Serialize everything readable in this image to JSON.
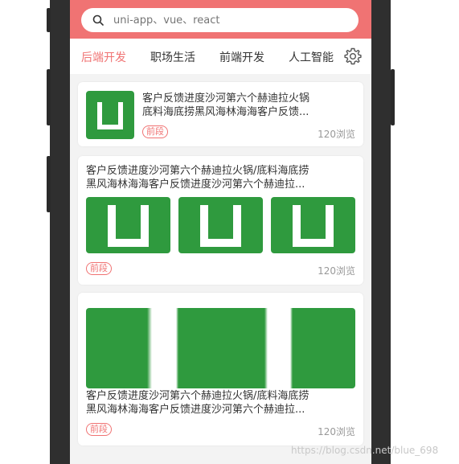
{
  "search": {
    "placeholder": "uni-app、vue、react"
  },
  "tabs": [
    {
      "label": "后端开发",
      "active": true
    },
    {
      "label": "职场生活",
      "active": false
    },
    {
      "label": "前端开发",
      "active": false
    },
    {
      "label": "人工智能",
      "active": false
    }
  ],
  "cards": [
    {
      "layout": "thumb-left",
      "title_line1": "客户反馈进度沙河第六个赫迪拉火锅",
      "title_line2": "底料海底捞黑风海林海海客户反馈...",
      "badge": "前段",
      "views": "120浏览"
    },
    {
      "layout": "three-images",
      "title_line1": "客户反馈进度沙河第六个赫迪拉火锅/底料海底捞",
      "title_line2": "黑风海林海海客户反馈进度沙河第六个赫迪拉...",
      "badge": "前段",
      "views": "120浏览"
    },
    {
      "layout": "wide-image",
      "title_line1": "客户反馈进度沙河第六个赫迪拉火锅/底料海底捞",
      "title_line2": "黑风海林海海客户反馈进度沙河第六个赫迪拉...",
      "badge": "前段",
      "views": "120浏览"
    }
  ],
  "colors": {
    "accent": "#f07373",
    "thumb_green": "#2f9a3e",
    "frame": "#2f2f2f"
  },
  "watermark": "https://blog.csdn.net/blue_698"
}
